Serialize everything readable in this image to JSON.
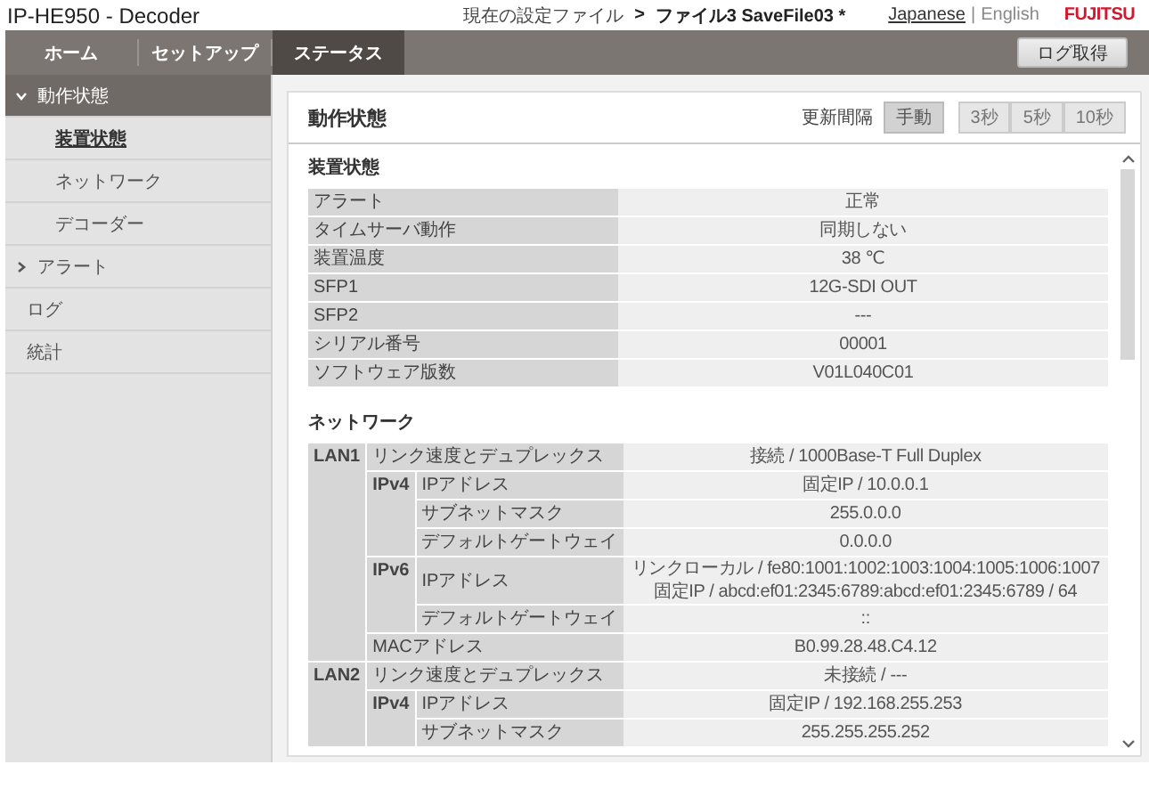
{
  "header": {
    "title": "IP-HE950 - Decoder",
    "config_label": "現在の設定ファイル",
    "config_arrow": ">",
    "config_file": "ファイル3 SaveFile03 *",
    "languages": [
      {
        "label": "Japanese",
        "selected": true
      },
      {
        "label": "English",
        "selected": false
      }
    ],
    "separator": "|",
    "logo": "FUJITSU"
  },
  "tabs": [
    {
      "label": "ホーム",
      "selected": false
    },
    {
      "label": "セットアップ",
      "selected": false
    },
    {
      "label": "ステータス",
      "selected": true
    }
  ],
  "log_button": "ログ取得",
  "sidebar": {
    "items": [
      {
        "label": "動作状態",
        "selected": true,
        "expanded": true,
        "children": [
          {
            "label": "装置状態",
            "selected": true
          },
          {
            "label": "ネットワーク",
            "selected": false
          },
          {
            "label": "デコーダー",
            "selected": false
          }
        ]
      },
      {
        "label": "アラート",
        "selected": false,
        "expanded": false
      },
      {
        "label": "ログ",
        "selected": false
      },
      {
        "label": "統計",
        "selected": false
      }
    ]
  },
  "panel": {
    "title": "動作状態",
    "refresh_label": "更新間隔",
    "refresh_options": [
      {
        "label": "手動",
        "selected": true
      },
      {
        "label": "3秒",
        "selected": false
      },
      {
        "label": "5秒",
        "selected": false
      },
      {
        "label": "10秒",
        "selected": false
      }
    ],
    "device": {
      "title": "装置状態",
      "rows": [
        {
          "label": "アラート",
          "value": "正常"
        },
        {
          "label": "タイムサーバ動作",
          "value": "同期しない"
        },
        {
          "label": "装置温度",
          "value": "38 ℃"
        },
        {
          "label": "SFP1",
          "value": "12G-SDI OUT"
        },
        {
          "label": "SFP2",
          "value": "---"
        },
        {
          "label": "シリアル番号",
          "value": "00001"
        },
        {
          "label": "ソフトウェア版数",
          "value": "V01L040C01"
        }
      ]
    },
    "network": {
      "title": "ネットワーク",
      "ports": [
        {
          "name": "LAN1",
          "items": [
            {
              "label": "リンク速度とデュプレックス",
              "value": [
                "接続 / 1000Base-T Full Duplex"
              ]
            },
            {
              "group": "IPv4",
              "items": [
                {
                  "label": "IPアドレス",
                  "value": [
                    "固定IP / 10.0.0.1"
                  ]
                },
                {
                  "label": "サブネットマスク",
                  "value": [
                    "255.0.0.0"
                  ]
                },
                {
                  "label": "デフォルトゲートウェイ",
                  "value": [
                    "0.0.0.0"
                  ]
                }
              ]
            },
            {
              "group": "IPv6",
              "items": [
                {
                  "label": "IPアドレス",
                  "value": [
                    "リンクローカル / fe80:1001:1002:1003:1004:1005:1006:1007",
                    "固定IP / abcd:ef01:2345:6789:abcd:ef01:2345:6789 / 64"
                  ]
                },
                {
                  "label": "デフォルトゲートウェイ",
                  "value": [
                    "::"
                  ]
                }
              ]
            },
            {
              "label": "MACアドレス",
              "value": [
                "B0.99.28.48.C4.12"
              ]
            }
          ]
        },
        {
          "name": "LAN2",
          "items": [
            {
              "label": "リンク速度とデュプレックス",
              "value": [
                "未接続 / ---"
              ]
            },
            {
              "group": "IPv4",
              "items": [
                {
                  "label": "IPアドレス",
                  "value": [
                    "固定IP / 192.168.255.253"
                  ]
                },
                {
                  "label": "サブネットマスク",
                  "value": [
                    "255.255.255.252"
                  ]
                }
              ]
            }
          ]
        }
      ]
    }
  }
}
